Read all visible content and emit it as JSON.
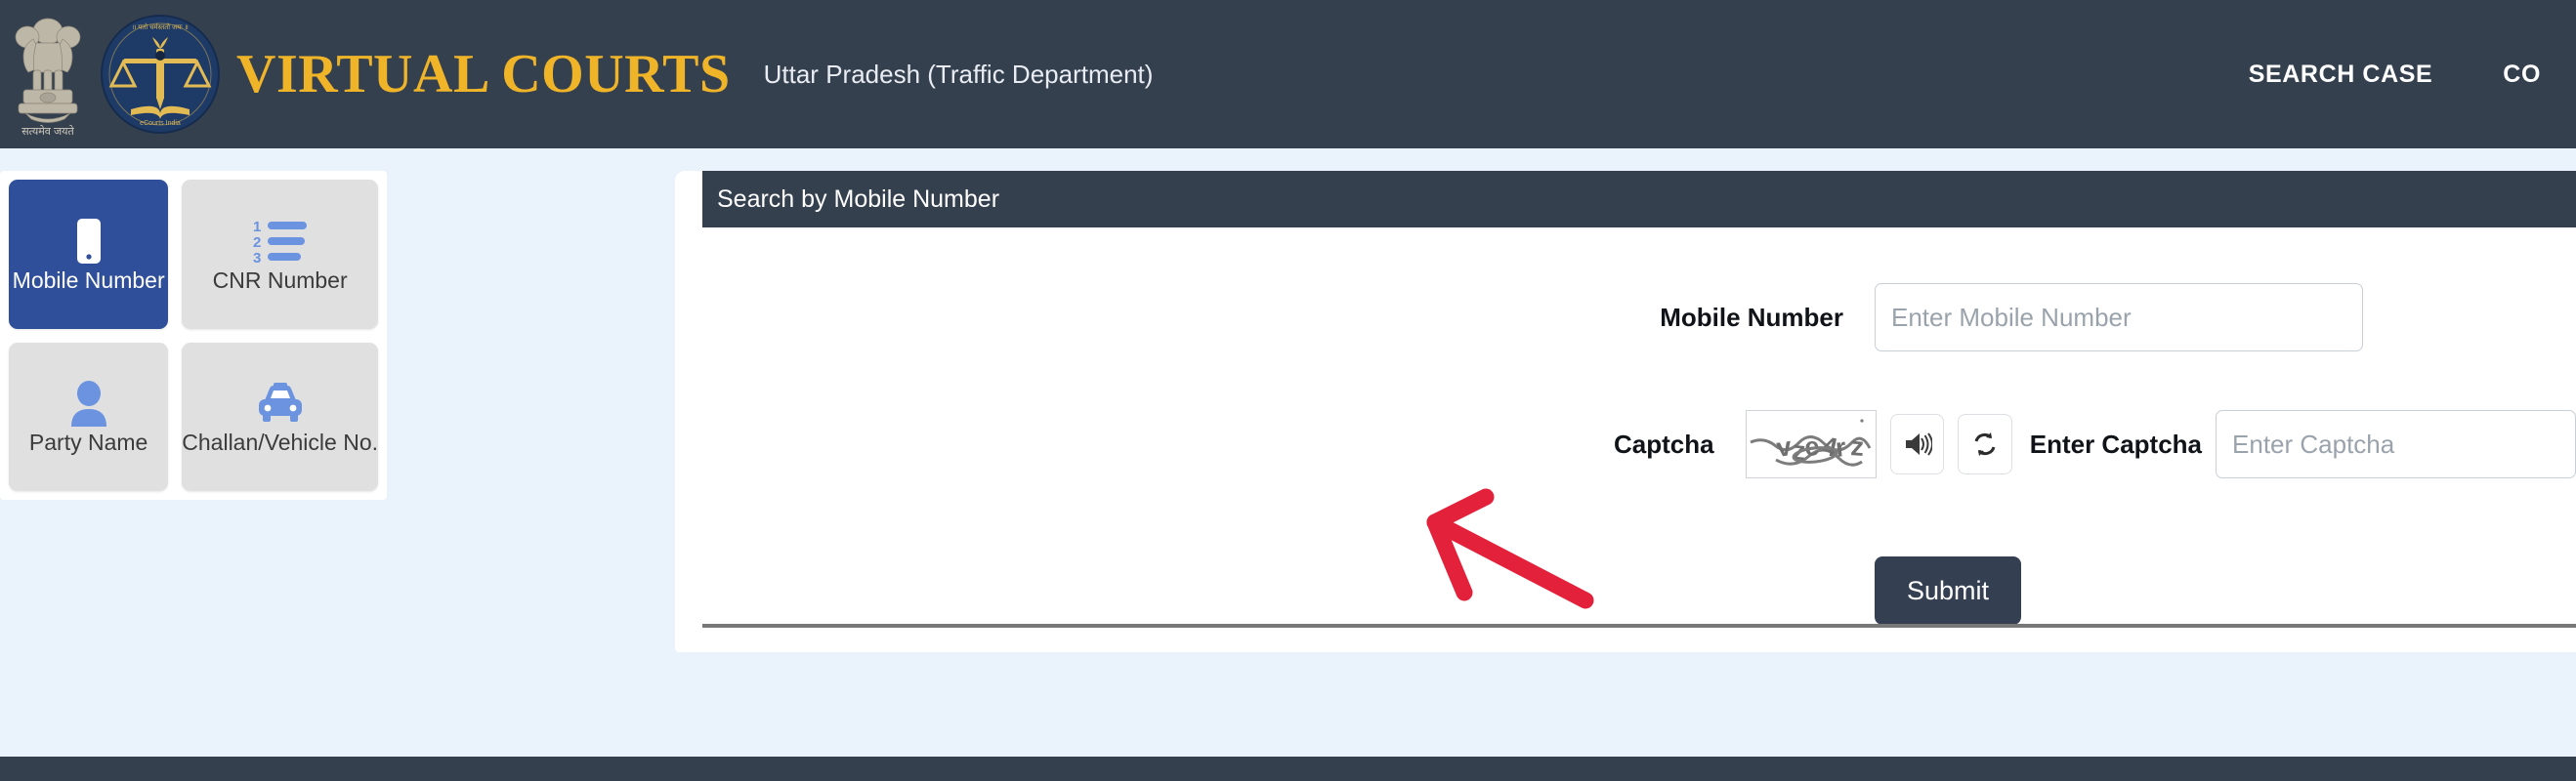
{
  "navbar": {
    "emblem_icon": "india-state-emblem-icon",
    "emblem_caption": "सत्यमेव जयते",
    "logo_icon": "ecourts-scales-logo-icon",
    "site_title": "VIRTUAL COURTS",
    "court_subtitle": "Uttar Pradesh (Traffic Department)",
    "links": [
      {
        "label": "SEARCH CASE"
      },
      {
        "label": "CO"
      }
    ],
    "bg_color": "#35404f",
    "title_color": "#f0b429"
  },
  "sidebar": {
    "tabs": [
      {
        "label": "Mobile Number",
        "icon": "mobile-phone-icon",
        "active": true
      },
      {
        "label": "CNR Number",
        "icon": "numbered-list-icon",
        "active": false
      },
      {
        "label": "Party Name",
        "icon": "person-icon",
        "active": false
      },
      {
        "label": "Challan/Vehicle No.",
        "icon": "car-taxi-icon",
        "active": false
      }
    ],
    "active_color": "#2f4f9a",
    "inactive_color": "#e0e0e0",
    "icon_color": "#6b93e0"
  },
  "main": {
    "card_header_title": "Search by Mobile Number",
    "fields": {
      "mobile": {
        "label": "Mobile Number",
        "value": "",
        "placeholder": "Enter Mobile Number"
      },
      "captcha": {
        "label": "Captcha",
        "image_text": "vze4rz",
        "audio_button_icon": "speaker-volume-icon",
        "refresh_button_icon": "refresh-sync-icon"
      },
      "enter_captcha": {
        "label": "Enter Captcha",
        "value": "",
        "placeholder": "Enter Captcha"
      }
    },
    "submit_label": "Submit",
    "submit_color": "#343f52"
  },
  "annotation": {
    "arrow_icon": "red-pointer-arrow-icon",
    "arrow_color": "#e3213a",
    "points_to": "Submit"
  },
  "page": {
    "background_color": "#eaf2fc",
    "footer_color": "#35404f"
  }
}
